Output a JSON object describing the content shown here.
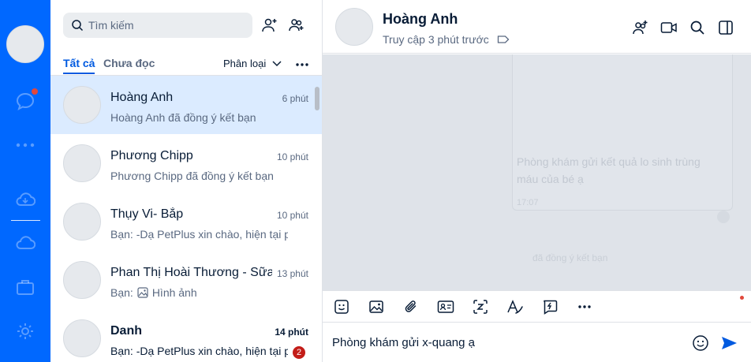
{
  "colors": {
    "rail": "#0068ff",
    "accent": "#005ae0",
    "active_row": "#dbebff",
    "unread_badge": "#c31d18",
    "notification_dot": "#e1483b"
  },
  "rail": {
    "icons": [
      "chat-icon",
      "more-icon",
      "cloud-sync-icon",
      "cloud-icon",
      "briefcase-icon",
      "settings-icon"
    ]
  },
  "search": {
    "placeholder": "Tìm kiếm"
  },
  "tabs": {
    "all": "Tất cả",
    "unread": "Chưa đọc",
    "filter": "Phân loại"
  },
  "conversations": [
    {
      "name": "Hoàng Anh",
      "time": "6 phút",
      "preview": "Hoàng Anh đã đồng ý kết bạn",
      "active": true
    },
    {
      "name": "Phương Chipp",
      "time": "10 phút",
      "preview": "Phương Chipp đã đồng ý kết bạn"
    },
    {
      "name": "Thụy Vi- Bắp",
      "time": "10 phút",
      "preview": "Bạn: -Dạ PetPlus xin chào, hiện tại phòn"
    },
    {
      "name": "Phan Thị Hoài Thương - Sữa ăn dặm",
      "time": "13 phút",
      "preview_prefix": "Bạn:",
      "preview": "Hình ảnh"
    },
    {
      "name": "Danh",
      "time": "14 phút",
      "preview": "Bạn: -Dạ PetPlus xin chào, hiện tại ph",
      "unread_count": "2"
    }
  ],
  "chat": {
    "title": "Hoàng Anh",
    "status": "Truy cập 3 phút trước",
    "ghost_message": "Phòng khám gửi kết quả lo sinh trùng máu của bé ạ",
    "ghost_time": "17:07",
    "ghost_note": "đã đồng ý kết bạn"
  },
  "composer": {
    "text": "Phòng khám gửi x-quang ạ"
  }
}
